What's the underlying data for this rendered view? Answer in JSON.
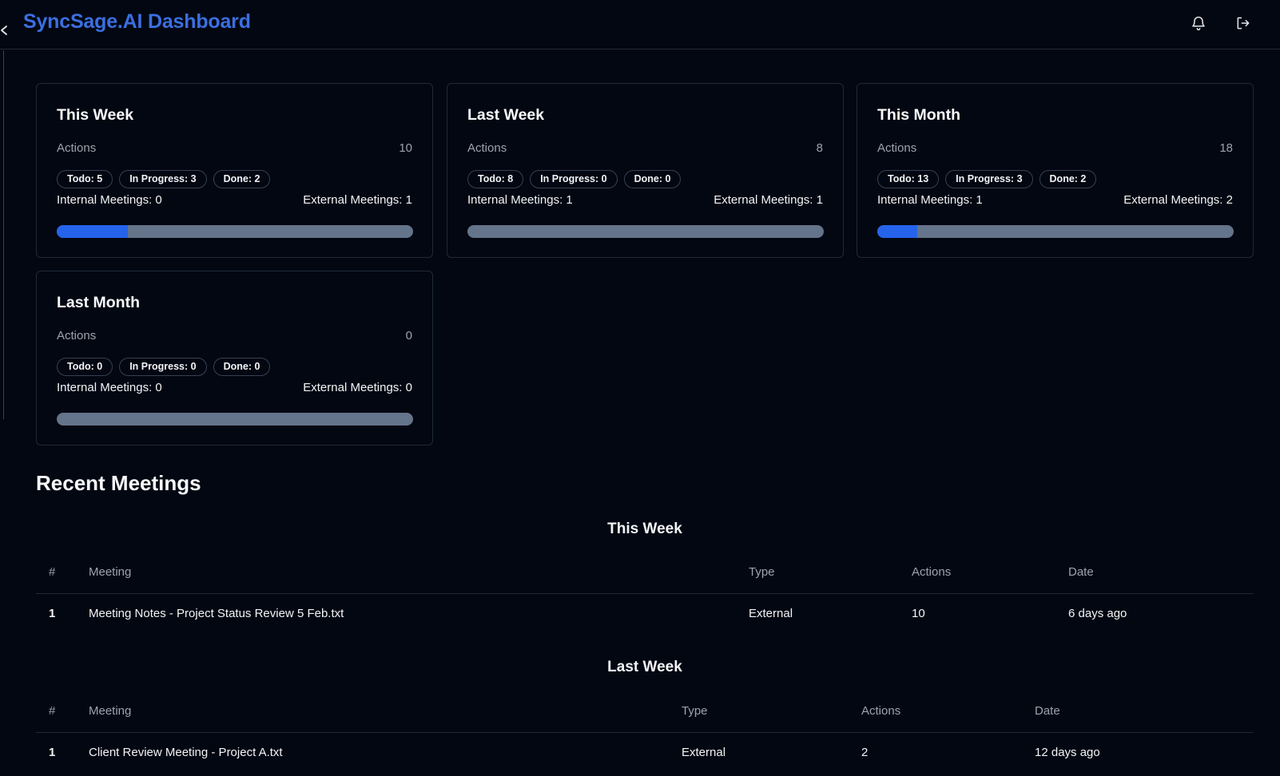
{
  "header": {
    "title": "SyncSage.AI Dashboard",
    "collapse_icon": "chevron-left-icon",
    "notifications_icon": "bell-icon",
    "logout_icon": "logout-icon"
  },
  "colors": {
    "background": "#030712",
    "accent": "#2563eb",
    "title": "#3b6fe0",
    "progress_track": "#64748b"
  },
  "stats": [
    {
      "title": "This Week",
      "actions_label": "Actions",
      "actions_count": "10",
      "badges": [
        "Todo: 5",
        "In Progress: 3",
        "Done: 2"
      ],
      "internal": "Internal Meetings: 0",
      "external": "External Meetings: 1",
      "progress": 0.2
    },
    {
      "title": "Last Week",
      "actions_label": "Actions",
      "actions_count": "8",
      "badges": [
        "Todo: 8",
        "In Progress: 0",
        "Done: 0"
      ],
      "internal": "Internal Meetings: 1",
      "external": "External Meetings: 1",
      "progress": 0
    },
    {
      "title": "This Month",
      "actions_label": "Actions",
      "actions_count": "18",
      "badges": [
        "Todo: 13",
        "In Progress: 3",
        "Done: 2"
      ],
      "internal": "Internal Meetings: 1",
      "external": "External Meetings: 2",
      "progress": 0.111
    },
    {
      "title": "Last Month",
      "actions_label": "Actions",
      "actions_count": "0",
      "badges": [
        "Todo: 0",
        "In Progress: 0",
        "Done: 0"
      ],
      "internal": "Internal Meetings: 0",
      "external": "External Meetings: 0",
      "progress": 0
    }
  ],
  "recent": {
    "title": "Recent Meetings",
    "groups": [
      {
        "title": "This Week",
        "columns": [
          "#",
          "Meeting",
          "Type",
          "Actions",
          "Date"
        ],
        "rows": [
          [
            "1",
            "Meeting Notes - Project Status Review 5 Feb.txt",
            "External",
            "10",
            "6 days ago"
          ]
        ]
      },
      {
        "title": "Last Week",
        "columns": [
          "#",
          "Meeting",
          "Type",
          "Actions",
          "Date"
        ],
        "rows": [
          [
            "1",
            "Client Review Meeting - Project A.txt",
            "External",
            "2",
            "12 days ago"
          ]
        ]
      }
    ]
  }
}
